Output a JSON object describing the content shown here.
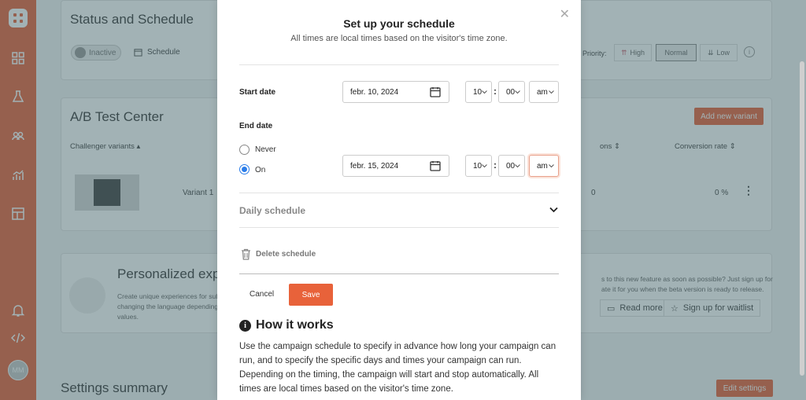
{
  "sidebar": {
    "avatar_initials": "MM",
    "icons": [
      "logo-icon",
      "dashboard-icon",
      "flask-icon",
      "users-icon",
      "analytics-icon",
      "layout-icon",
      "bell-icon",
      "code-icon"
    ]
  },
  "background": {
    "status_card": {
      "title": "Status and Schedule",
      "toggle_label": "Inactive",
      "schedule_label": "Schedule",
      "priority_label": "Priority:",
      "priority_options": [
        "High",
        "Normal",
        "Low"
      ]
    },
    "ab_card": {
      "title": "A/B Test Center",
      "add_variant": "Add new variant",
      "col_challenger": "Challenger variants",
      "col_conversions": "ons",
      "col_rate": "Conversion rate",
      "row_variant": "Variant 1",
      "row_conversions": "0",
      "row_rate": "0 %"
    },
    "personalized_card": {
      "title": "Personalized exp",
      "desc_left": "Create unique experiences for sub\nchanging the language depending\nvalues.",
      "desc_right": "s to this new feature as soon as possible? Just sign up for\nate it for you when the beta version is ready to release.",
      "read_more": "Read more",
      "waitlist": "Sign up for waitlist"
    },
    "settings": {
      "title": "Settings summary",
      "edit": "Edit settings"
    }
  },
  "modal": {
    "title": "Set up your schedule",
    "subtitle": "All times are local times based on the visitor's time zone.",
    "start": {
      "label": "Start date",
      "date": "febr. 10, 2024",
      "hour": "10",
      "minute": "00",
      "ampm": "am"
    },
    "end": {
      "label": "End date",
      "never_label": "Never",
      "on_label": "On",
      "date": "febr. 15, 2024",
      "hour": "10",
      "minute": "00",
      "ampm": "am"
    },
    "daily_schedule": "Daily schedule",
    "delete_schedule": "Delete schedule",
    "cancel": "Cancel",
    "save": "Save",
    "how_title": "How it works",
    "how_text": "Use the campaign schedule to specify in advance how long your campaign can run, and to specify the specific days and times your campaign can run. Depending on the timing, the campaign will start and stop automatically. All times are local times based on the visitor's time zone."
  },
  "colors": {
    "brand": "#e8623a",
    "radio_checked": "#2b7de9"
  }
}
